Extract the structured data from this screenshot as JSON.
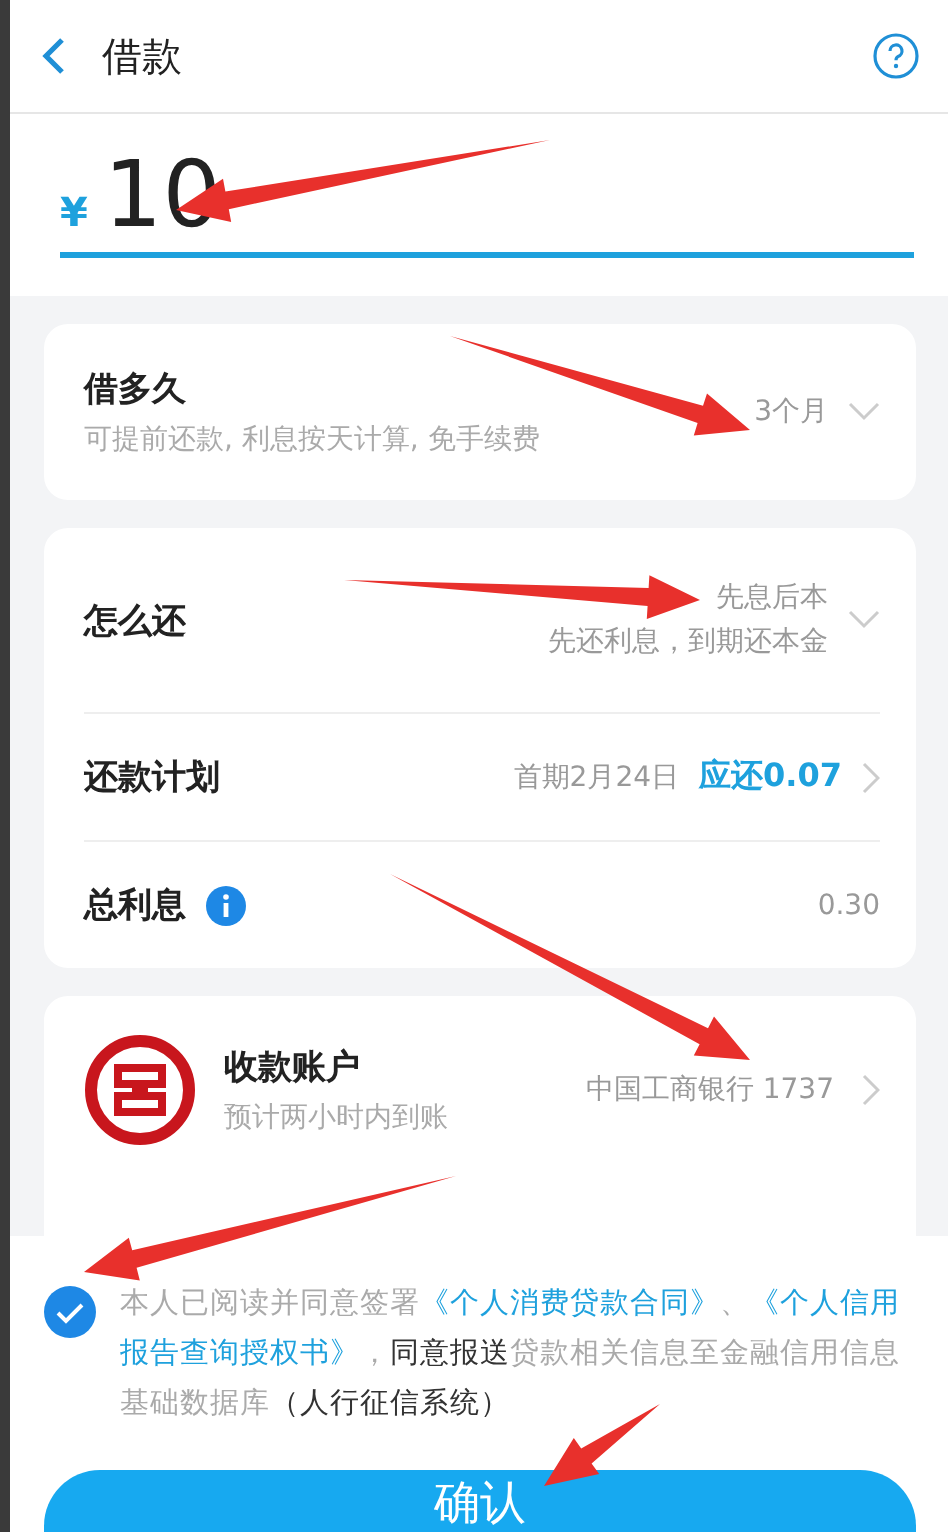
{
  "header": {
    "title": "借款"
  },
  "amount": {
    "currency": "¥",
    "value": "10"
  },
  "term": {
    "label": "借多久",
    "hint": "可提前还款, 利息按天计算, 免手续费",
    "value": "3个月"
  },
  "repay": {
    "label": "怎么还",
    "value": "先息后本",
    "detail": "先还利息，到期还本金"
  },
  "plan": {
    "label": "还款计划",
    "first": "首期2月24日",
    "due": "应还0.07"
  },
  "interest": {
    "label": "总利息",
    "value": "0.30"
  },
  "account": {
    "label": "收款账户",
    "hint": "预计两小时内到账",
    "bank": "中国工商银行 1737"
  },
  "agreement": {
    "checked": true,
    "segments": [
      {
        "kind": "plain",
        "text": "本人已阅读并同意签署"
      },
      {
        "kind": "link",
        "text": "《个人消费贷款合同》"
      },
      {
        "kind": "plain",
        "text": "、"
      },
      {
        "kind": "link",
        "text": "《个人信用"
      },
      {
        "kind": "link",
        "text": "报告查询授权书》"
      },
      {
        "kind": "plain",
        "text": "，"
      },
      {
        "kind": "strong",
        "text": "同意报送"
      },
      {
        "kind": "plain",
        "text": "贷款相关信息至金融信用信息基础数据库"
      },
      {
        "kind": "strong",
        "text": "（人行征信系统）"
      }
    ]
  },
  "confirm": {
    "label": "确认"
  }
}
